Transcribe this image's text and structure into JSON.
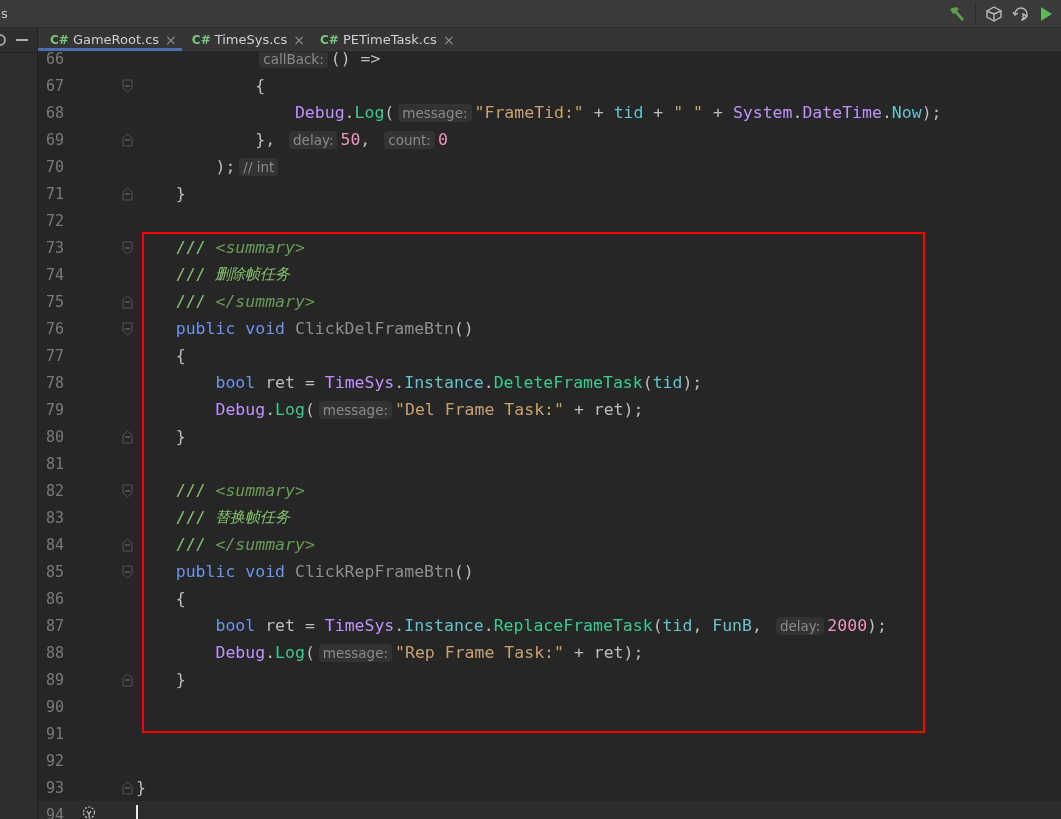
{
  "toolbar": {
    "title_fragment": "s"
  },
  "tabs": [
    {
      "icon_text": "C#",
      "label": "GameRoot.cs",
      "close": "×",
      "selected": true
    },
    {
      "icon_text": "C#",
      "label": "TimeSys.cs",
      "close": "×",
      "selected": false
    },
    {
      "icon_text": "C#",
      "label": "PETimeTask.cs",
      "close": "×",
      "selected": false
    }
  ],
  "editor": {
    "lines": [
      {
        "children": [
          {
            "children": [
              {
                "children": [
                  {
                    "number": "66",
                    "fold_start": false,
                    "fold_end": false,
                    "current": false,
                    "tokens": [
                      {
                        "kind": "hint",
                        "text": "callBack:"
                      },
                      {
                        "kind": "plain",
                        "text": "() =>"
                      }
                    ]
                  },
                  {
                    "number": "67",
                    "fold_start": true,
                    "fold_end": false,
                    "current": false,
                    "tokens": [
                      {
                        "kind": "plain",
                        "text": "{"
                      }
                    ]
                  },
                  {
                    "children": [
                      {
                        "number": "68",
                        "fold_start": false,
                        "fold_end": false,
                        "current": false,
                        "tokens": [
                          {
                            "kind": "class",
                            "text": "Debug"
                          },
                          {
                            "kind": "plain",
                            "text": "."
                          },
                          {
                            "kind": "method",
                            "text": "Log"
                          },
                          {
                            "kind": "plain",
                            "text": "("
                          },
                          {
                            "kind": "hint",
                            "text": "message:"
                          },
                          {
                            "kind": "string",
                            "text": "\"FrameTid:\""
                          },
                          {
                            "kind": "plain",
                            "text": " + "
                          },
                          {
                            "kind": "field",
                            "text": "tid"
                          },
                          {
                            "kind": "plain",
                            "text": " + "
                          },
                          {
                            "kind": "string",
                            "text": "\" \""
                          },
                          {
                            "kind": "plain",
                            "text": " + "
                          },
                          {
                            "kind": "class",
                            "text": "System"
                          },
                          {
                            "kind": "plain",
                            "text": "."
                          },
                          {
                            "kind": "class",
                            "text": "DateTime"
                          },
                          {
                            "kind": "plain",
                            "text": "."
                          },
                          {
                            "kind": "field",
                            "text": "Now"
                          },
                          {
                            "kind": "plain",
                            "text": ");"
                          }
                        ]
                      }
                    ]
                  },
                  {
                    "number": "69",
                    "fold_start": false,
                    "fold_end": true,
                    "current": false,
                    "tokens": [
                      {
                        "kind": "plain",
                        "text": "}, "
                      },
                      {
                        "kind": "hint",
                        "text": "delay:"
                      },
                      {
                        "kind": "number",
                        "text": "50"
                      },
                      {
                        "kind": "plain",
                        "text": ", "
                      },
                      {
                        "kind": "hint",
                        "text": "count:"
                      },
                      {
                        "kind": "number",
                        "text": "0"
                      }
                    ]
                  }
                ]
              },
              {
                "number": "70",
                "fold_start": false,
                "fold_end": false,
                "current": false,
                "tokens": [
                  {
                    "kind": "plain",
                    "text": ");"
                  },
                  {
                    "kind": "hint",
                    "text": "// int"
                  }
                ]
              }
            ]
          },
          {
            "number": "71",
            "fold_start": false,
            "fold_end": true,
            "current": false,
            "tokens": [
              {
                "kind": "plain",
                "text": "}"
              }
            ]
          },
          {
            "number": "72",
            "fold_start": false,
            "fold_end": false,
            "current": false
          },
          {
            "number": "73",
            "fold_start": true,
            "fold_end": false,
            "current": false,
            "tokens": [
              {
                "kind": "doc",
                "text": "/// "
              },
              {
                "kind": "doctag",
                "text": "<summary>"
              }
            ]
          },
          {
            "number": "74",
            "fold_start": false,
            "fold_end": false,
            "current": false,
            "tokens": [
              {
                "kind": "doc",
                "text": "/// "
              },
              {
                "kind": "doctext",
                "text": "删除帧任务"
              }
            ]
          },
          {
            "number": "75",
            "fold_start": false,
            "fold_end": true,
            "current": false,
            "tokens": [
              {
                "kind": "doc",
                "text": "/// "
              },
              {
                "kind": "doctag",
                "text": "</summary>"
              }
            ]
          },
          {
            "number": "76",
            "fold_start": true,
            "fold_end": false,
            "current": false,
            "tokens": [
              {
                "kind": "keyword",
                "text": "public void "
              },
              {
                "kind": "unused",
                "text": "ClickDelFrameBtn"
              },
              {
                "kind": "plain",
                "text": "()"
              }
            ]
          },
          {
            "number": "77",
            "fold_start": false,
            "fold_end": false,
            "current": false,
            "tokens": [
              {
                "kind": "plain",
                "text": "{"
              }
            ]
          },
          {
            "children": [
              {
                "number": "78",
                "fold_start": false,
                "fold_end": false,
                "current": false,
                "tokens": [
                  {
                    "kind": "keyword",
                    "text": "bool"
                  },
                  {
                    "kind": "plain",
                    "text": " ret = "
                  },
                  {
                    "kind": "class",
                    "text": "TimeSys"
                  },
                  {
                    "kind": "plain",
                    "text": "."
                  },
                  {
                    "kind": "field",
                    "text": "Instance"
                  },
                  {
                    "kind": "plain",
                    "text": "."
                  },
                  {
                    "kind": "method",
                    "text": "DeleteFrameTask"
                  },
                  {
                    "kind": "plain",
                    "text": "("
                  },
                  {
                    "kind": "field",
                    "text": "tid"
                  },
                  {
                    "kind": "plain",
                    "text": ");"
                  }
                ]
              },
              {
                "number": "79",
                "fold_start": false,
                "fold_end": false,
                "current": false,
                "tokens": [
                  {
                    "kind": "class",
                    "text": "Debug"
                  },
                  {
                    "kind": "plain",
                    "text": "."
                  },
                  {
                    "kind": "method",
                    "text": "Log"
                  },
                  {
                    "kind": "plain",
                    "text": "("
                  },
                  {
                    "kind": "hint",
                    "text": "message:"
                  },
                  {
                    "kind": "string",
                    "text": "\"Del Frame Task:\""
                  },
                  {
                    "kind": "plain",
                    "text": " + ret);"
                  }
                ]
              }
            ]
          },
          {
            "number": "80",
            "fold_start": false,
            "fold_end": true,
            "current": false,
            "tokens": [
              {
                "kind": "plain",
                "text": "}"
              }
            ]
          },
          {
            "number": "81",
            "fold_start": false,
            "fold_end": false,
            "current": false
          },
          {
            "number": "82",
            "fold_start": true,
            "fold_end": false,
            "current": false,
            "tokens": [
              {
                "kind": "doc",
                "text": "/// "
              },
              {
                "kind": "doctag",
                "text": "<summary>"
              }
            ]
          },
          {
            "number": "83",
            "fold_start": false,
            "fold_end": false,
            "current": false,
            "tokens": [
              {
                "kind": "doc",
                "text": "/// "
              },
              {
                "kind": "doctext",
                "text": "替换帧任务"
              }
            ]
          },
          {
            "number": "84",
            "fold_start": false,
            "fold_end": true,
            "current": false,
            "tokens": [
              {
                "kind": "doc",
                "text": "/// "
              },
              {
                "kind": "doctag",
                "text": "</summary>"
              }
            ]
          },
          {
            "number": "85",
            "fold_start": true,
            "fold_end": false,
            "current": false,
            "tokens": [
              {
                "kind": "keyword",
                "text": "public void "
              },
              {
                "kind": "unused",
                "text": "ClickRepFrameBtn"
              },
              {
                "kind": "plain",
                "text": "()"
              }
            ]
          },
          {
            "number": "86",
            "fold_start": false,
            "fold_end": false,
            "current": false,
            "tokens": [
              {
                "kind": "plain",
                "text": "{"
              }
            ]
          },
          {
            "children": [
              {
                "number": "87",
                "fold_start": false,
                "fold_end": false,
                "current": false,
                "tokens": [
                  {
                    "kind": "keyword",
                    "text": "bool"
                  },
                  {
                    "kind": "plain",
                    "text": " ret = "
                  },
                  {
                    "kind": "class",
                    "text": "TimeSys"
                  },
                  {
                    "kind": "plain",
                    "text": "."
                  },
                  {
                    "kind": "field",
                    "text": "Instance"
                  },
                  {
                    "kind": "plain",
                    "text": "."
                  },
                  {
                    "kind": "method",
                    "text": "ReplaceFrameTask"
                  },
                  {
                    "kind": "plain",
                    "text": "("
                  },
                  {
                    "kind": "field",
                    "text": "tid"
                  },
                  {
                    "kind": "plain",
                    "text": ", "
                  },
                  {
                    "kind": "field",
                    "text": "FunB"
                  },
                  {
                    "kind": "plain",
                    "text": ", "
                  },
                  {
                    "kind": "hint",
                    "text": "delay:"
                  },
                  {
                    "kind": "number",
                    "text": "2000"
                  },
                  {
                    "kind": "plain",
                    "text": ");"
                  }
                ]
              },
              {
                "number": "88",
                "fold_start": false,
                "fold_end": false,
                "current": false,
                "tokens": [
                  {
                    "kind": "class",
                    "text": "Debug"
                  },
                  {
                    "kind": "plain",
                    "text": "."
                  },
                  {
                    "kind": "method",
                    "text": "Log"
                  },
                  {
                    "kind": "plain",
                    "text": "("
                  },
                  {
                    "kind": "hint",
                    "text": "message:"
                  },
                  {
                    "kind": "string",
                    "text": "\"Rep Frame Task:\""
                  },
                  {
                    "kind": "plain",
                    "text": " + ret);"
                  }
                ]
              }
            ]
          },
          {
            "number": "89",
            "fold_start": false,
            "fold_end": true,
            "current": false,
            "tokens": [
              {
                "kind": "plain",
                "text": "}"
              }
            ]
          },
          {
            "number": "90",
            "fold_start": false,
            "fold_end": false,
            "current": false
          },
          {
            "number": "91",
            "fold_start": false,
            "fold_end": false,
            "current": false
          },
          {
            "number": "92",
            "fold_start": false,
            "fold_end": false,
            "current": false
          }
        ]
      },
      {
        "number": "93",
        "fold_start": false,
        "fold_end": true,
        "current": false,
        "tokens": [
          {
            "kind": "plain",
            "text": "}"
          }
        ]
      },
      {
        "number": "94",
        "fold_start": false,
        "fold_end": false,
        "current": true
      }
    ]
  }
}
